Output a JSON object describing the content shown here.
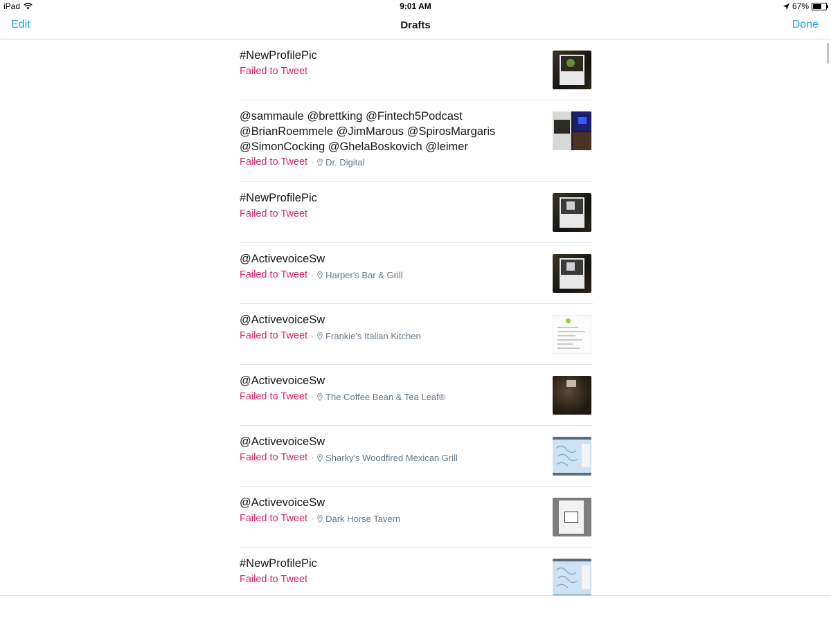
{
  "status_bar": {
    "device": "iPad",
    "time": "9:01 AM",
    "battery_percent": "67%",
    "battery_level": 0.67
  },
  "nav": {
    "title": "Drafts",
    "edit_label": "Edit",
    "done_label": "Done"
  },
  "colors": {
    "accent": "#1da1f2",
    "failed": "#e0245e",
    "location": "#657786"
  },
  "drafts": [
    {
      "text": "#NewProfilePic",
      "status": "Failed to Tweet",
      "location": "",
      "thumbnail": "dark-screen-photo"
    },
    {
      "text": "@sammaule @brettking @Fintech5Podcast\n@BrianRoemmele @JimMarous @SpirosMargaris\n@SimonCocking @GhelaBoskovich @leimer",
      "status": "Failed to Tweet",
      "location": "Dr. Digital",
      "thumbnail": "split-photo"
    },
    {
      "text": "#NewProfilePic",
      "status": "Failed to Tweet",
      "location": "",
      "thumbnail": "dark-screen-photo"
    },
    {
      "text": "@ActivevoiceSw",
      "status": "Failed to Tweet",
      "location": "Harper's Bar & Grill",
      "thumbnail": "dark-screen-photo"
    },
    {
      "text": "@ActivevoiceSw",
      "status": "Failed to Tweet",
      "location": "Frankie's Italian Kitchen",
      "thumbnail": "document-photo"
    },
    {
      "text": "@ActivevoiceSw",
      "status": "Failed to Tweet",
      "location": "The Coffee Bean & Tea Leaf®",
      "thumbnail": "room-photo"
    },
    {
      "text": "@ActivevoiceSw",
      "status": "Failed to Tweet",
      "location": "Sharky's Woodfired Mexican Grill",
      "thumbnail": "map-photo"
    },
    {
      "text": "@ActivevoiceSw",
      "status": "Failed to Tweet",
      "location": "Dark Horse Tavern",
      "thumbnail": "gray-document-photo"
    },
    {
      "text": "#NewProfilePic",
      "status": "Failed to Tweet",
      "location": "",
      "thumbnail": "map-photo"
    }
  ]
}
